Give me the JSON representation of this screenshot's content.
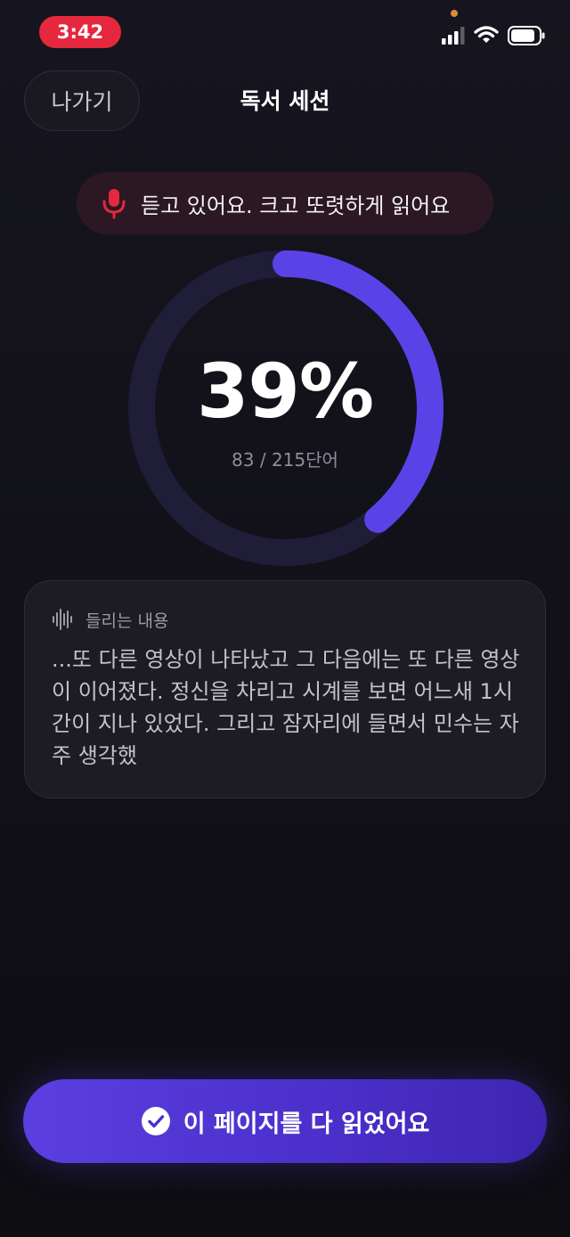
{
  "status_bar": {
    "time": "3:42",
    "icons": [
      "signal-icon",
      "wifi-icon",
      "battery-icon"
    ]
  },
  "header": {
    "exit_label": "나가기",
    "title": "독서 세션"
  },
  "listening": {
    "text": "듣고 있어요. 크고 또렷하게 읽어요",
    "icon": "mic-icon"
  },
  "progress": {
    "percent_label": "39%",
    "fraction": 0.39,
    "word_count": "83 / 215단어"
  },
  "transcript": {
    "heading": "들리는 내용",
    "icon": "waveform-icon",
    "text": "...또 다른 영상이 나타났고 그 다음에는 또 다른 영상이 이어졌다. 정신을 차리고 시계를 보면 어느새 1시간이 지나 있었다. 그리고 잠자리에 들면서 민수는 자주 생각했"
  },
  "action": {
    "done_label": "이 페이지를 다 읽었어요",
    "icon": "check-circle-icon"
  },
  "colors": {
    "accent": "#5b3fe0",
    "ring_track": "#1f1d38",
    "ring_fill": "#5a43e6",
    "recording_red": "#e5283e",
    "background": "#131219"
  }
}
